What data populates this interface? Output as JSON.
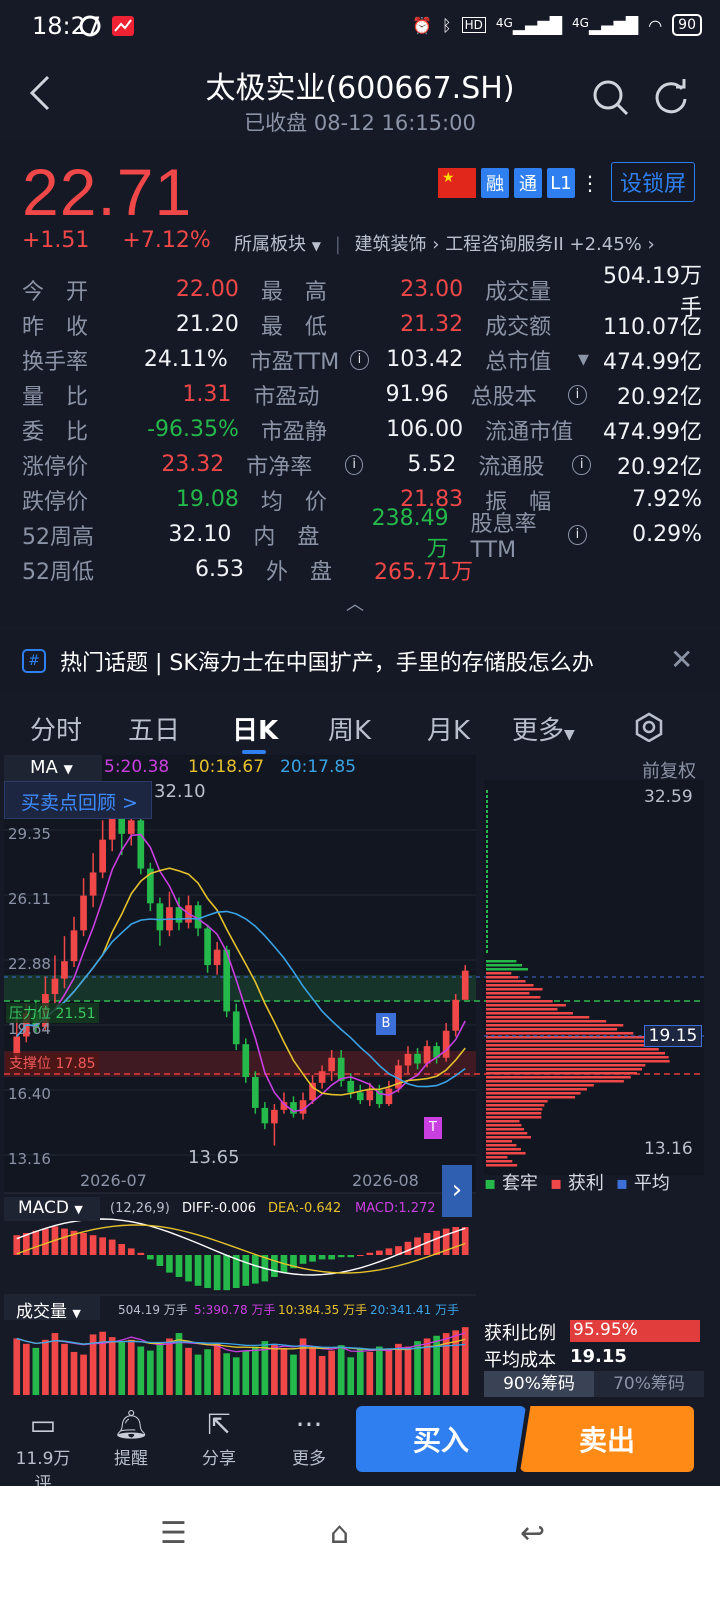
{
  "status": {
    "time": "18:27",
    "battery": "90",
    "net1": "4G",
    "net2": "4G",
    "hd": "HD"
  },
  "header": {
    "title": "太极实业(600667.SH)",
    "subtitle": "已收盘 08-12 16:15:00"
  },
  "quote": {
    "price": "22.71",
    "change": "+1.51",
    "change_pct": "+7.12%",
    "sector_label": "所属板块",
    "sector1": "建筑装饰",
    "sector2": "工程咨询服务II +2.45%",
    "badges": [
      "融",
      "通",
      "L1"
    ],
    "lock_label": "设锁屏",
    "rows": [
      [
        {
          "l": "今　开",
          "v": "22.00",
          "c": "red"
        },
        {
          "l": "最　高",
          "v": "23.00",
          "c": "red"
        },
        {
          "l": "成交量",
          "v": "504.19万手",
          "c": "white"
        }
      ],
      [
        {
          "l": "昨　收",
          "v": "21.20",
          "c": "white"
        },
        {
          "l": "最　低",
          "v": "21.32",
          "c": "red"
        },
        {
          "l": "成交额",
          "v": "110.07亿",
          "c": "white"
        }
      ],
      [
        {
          "l": "换手率",
          "v": "24.11%",
          "c": "white"
        },
        {
          "l": "市盈TTM",
          "v": "103.42",
          "c": "white",
          "i": true
        },
        {
          "l": "总市值",
          "v": "474.99亿",
          "c": "white",
          "dd": true
        }
      ],
      [
        {
          "l": "量　比",
          "v": "1.31",
          "c": "red"
        },
        {
          "l": "市盈动",
          "v": "91.96",
          "c": "white"
        },
        {
          "l": "总股本",
          "v": "20.92亿",
          "c": "white",
          "i": true
        }
      ],
      [
        {
          "l": "委　比",
          "v": "-96.35%",
          "c": "green"
        },
        {
          "l": "市盈静",
          "v": "106.00",
          "c": "white"
        },
        {
          "l": "流通市值",
          "v": "474.99亿",
          "c": "white"
        }
      ],
      [
        {
          "l": "涨停价",
          "v": "23.32",
          "c": "red"
        },
        {
          "l": "市净率",
          "v": "5.52",
          "c": "white",
          "i": true
        },
        {
          "l": "流通股",
          "v": "20.92亿",
          "c": "white",
          "i": true
        }
      ],
      [
        {
          "l": "跌停价",
          "v": "19.08",
          "c": "green"
        },
        {
          "l": "均　价",
          "v": "21.83",
          "c": "red"
        },
        {
          "l": "振　幅",
          "v": "7.92%",
          "c": "white"
        }
      ],
      [
        {
          "l": "52周高",
          "v": "32.10",
          "c": "white"
        },
        {
          "l": "内　盘",
          "v": "238.49万",
          "c": "green"
        },
        {
          "l": "股息率TTM",
          "v": "0.29%",
          "c": "white",
          "i": true
        }
      ],
      [
        {
          "l": "52周低",
          "v": "6.53",
          "c": "white"
        },
        {
          "l": "外　盘",
          "v": "265.71万",
          "c": "red"
        }
      ]
    ]
  },
  "topic": {
    "text": "热门话题 | SK海力士在中国扩产，手里的存储股怎么办"
  },
  "tabs": [
    "分时",
    "五日",
    "日K",
    "周K",
    "月K",
    "更多"
  ],
  "chart": {
    "ma_label": "MA",
    "ma5": "5:20.38",
    "ma10": "10:18.67",
    "ma20": "20:17.85",
    "fuquan": "前复权",
    "review_btn": "买卖点回顾 >",
    "high_mark": "32.10",
    "low_mark": "13.65",
    "yticks": [
      "29.35",
      "26.11",
      "22.88",
      "19.64",
      "16.40",
      "13.16"
    ],
    "resist": "压力位 21.51",
    "support": "支撑位 17.85",
    "xlabels": [
      "2026-07",
      "2026-08"
    ],
    "chip_top": "32.59",
    "chip_bottom": "13.16",
    "chip_avg": "19.15",
    "legend": [
      "套牢",
      "获利",
      "平均"
    ],
    "macd_label": "MACD",
    "macd_params": "(12,26,9)",
    "diff": "DIFF:-0.006",
    "dea": "DEA:-0.642",
    "macd": "MACD:1.272",
    "vol_label": "成交量",
    "vol_now": "504.19 万手",
    "vol5": "5:390.78 万手",
    "vol10": "10:384.35 万手",
    "vol20": "20:341.41 万手",
    "profit_label": "获利比例",
    "profit_val": "95.95%",
    "avgcost_label": "平均成本",
    "avgcost_val": "19.15",
    "chip90": "90%筹码",
    "chip70": "70%筹码",
    "b_mark": "B",
    "t_mark": "T"
  },
  "bottom": {
    "comment": "11.9万评",
    "remind": "提醒",
    "share": "分享",
    "more": "更多",
    "buy": "买入",
    "sell": "卖出"
  },
  "chart_data": {
    "type": "candlestick",
    "ylim": [
      13.16,
      32.59
    ],
    "candles": [
      [
        18.2,
        19.3,
        20.3,
        18.0
      ],
      [
        19.3,
        20.5,
        21.0,
        19.0
      ],
      [
        20.5,
        19.8,
        21.2,
        19.5
      ],
      [
        19.8,
        21.5,
        22.4,
        19.6
      ],
      [
        21.5,
        22.3,
        23.5,
        21.0
      ],
      [
        22.3,
        23.2,
        24.5,
        21.8
      ],
      [
        23.2,
        24.8,
        25.5,
        22.9
      ],
      [
        24.8,
        26.6,
        27.5,
        24.5
      ],
      [
        26.6,
        27.8,
        28.8,
        26.0
      ],
      [
        27.8,
        29.5,
        30.5,
        27.5
      ],
      [
        29.5,
        31.0,
        32.1,
        28.9
      ],
      [
        31.0,
        29.8,
        31.5,
        28.7
      ],
      [
        29.8,
        30.5,
        31.2,
        29.2
      ],
      [
        30.5,
        28.0,
        30.8,
        27.7
      ],
      [
        28.0,
        26.2,
        28.3,
        25.8
      ],
      [
        26.2,
        24.8,
        26.5,
        24.0
      ],
      [
        24.8,
        26.0,
        26.8,
        24.5
      ],
      [
        26.0,
        25.2,
        26.5,
        24.8
      ],
      [
        25.2,
        26.1,
        26.6,
        24.9
      ],
      [
        26.1,
        24.9,
        26.3,
        24.5
      ],
      [
        24.9,
        23.0,
        25.1,
        22.6
      ],
      [
        23.0,
        23.8,
        24.2,
        22.5
      ],
      [
        23.8,
        20.6,
        24.0,
        20.3
      ],
      [
        20.6,
        18.9,
        21.0,
        18.6
      ],
      [
        18.9,
        17.2,
        19.2,
        16.9
      ],
      [
        17.2,
        15.6,
        17.5,
        15.3
      ],
      [
        15.6,
        14.8,
        15.9,
        14.5
      ],
      [
        14.8,
        15.5,
        15.8,
        13.65
      ],
      [
        15.5,
        15.9,
        16.4,
        15.3
      ],
      [
        15.9,
        15.3,
        16.2,
        15.1
      ],
      [
        15.3,
        16.0,
        16.4,
        15.0
      ],
      [
        16.0,
        16.9,
        17.3,
        15.8
      ],
      [
        16.9,
        17.5,
        17.8,
        16.6
      ],
      [
        17.5,
        18.2,
        18.6,
        17.0
      ],
      [
        18.2,
        17.0,
        18.6,
        16.7
      ],
      [
        17.0,
        16.4,
        17.4,
        16.1
      ],
      [
        16.4,
        16.0,
        16.8,
        15.8
      ],
      [
        16.0,
        16.5,
        16.9,
        15.7
      ],
      [
        16.5,
        15.8,
        16.8,
        15.6
      ],
      [
        15.8,
        16.6,
        17.0,
        15.7
      ],
      [
        16.6,
        17.8,
        18.1,
        16.4
      ],
      [
        17.8,
        18.4,
        18.8,
        17.4
      ],
      [
        18.4,
        17.9,
        18.7,
        17.6
      ],
      [
        17.9,
        18.8,
        19.1,
        17.7
      ],
      [
        18.8,
        18.2,
        19.0,
        17.9
      ],
      [
        18.2,
        19.6,
        20.0,
        18.0
      ],
      [
        19.6,
        21.2,
        21.5,
        19.3
      ],
      [
        21.2,
        22.71,
        23.0,
        21.32
      ]
    ],
    "macd_hist": [
      0.9,
      1.0,
      1.1,
      1.2,
      1.3,
      1.2,
      1.1,
      1.0,
      0.9,
      0.8,
      0.7,
      0.5,
      0.3,
      0.1,
      -0.2,
      -0.5,
      -0.8,
      -1.0,
      -1.2,
      -1.4,
      -1.5,
      -1.6,
      -1.6,
      -1.5,
      -1.4,
      -1.3,
      -1.2,
      -1.0,
      -0.8,
      -0.6,
      -0.4,
      -0.3,
      -0.2,
      -0.2,
      -0.1,
      -0.1,
      0.0,
      0.1,
      0.2,
      0.3,
      0.4,
      0.6,
      0.8,
      1.0,
      1.1,
      1.2,
      1.27,
      1.272
    ],
    "volumes": [
      420,
      380,
      350,
      410,
      460,
      380,
      320,
      300,
      450,
      470,
      430,
      390,
      410,
      360,
      330,
      380,
      420,
      460,
      350,
      300,
      340,
      380,
      310,
      280,
      330,
      360,
      400,
      380,
      350,
      300,
      420,
      360,
      290,
      330,
      370,
      280,
      350,
      320,
      360,
      340,
      380,
      360,
      400,
      420,
      440,
      460,
      480,
      504
    ]
  }
}
